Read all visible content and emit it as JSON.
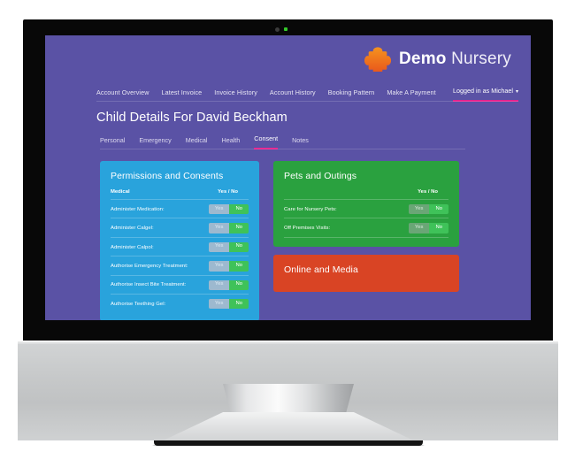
{
  "device": {
    "type": "desktop-monitor-mockup",
    "webcam_led_color": "#34c82a"
  },
  "site": {
    "brand_bold": "Demo",
    "brand_light": "Nursery",
    "logo_icon": "puzzle-piece-icon",
    "header_bg": "#5a52a5",
    "accent_pink": "#e91e8c"
  },
  "top_nav": {
    "links": [
      "Account Overview",
      "Latest Invoice",
      "Invoice History",
      "Account History",
      "Booking Pattern",
      "Make A Payment"
    ],
    "user_label": "Logged in as Michael",
    "caret": "▾"
  },
  "page": {
    "title": "Child Details For David Beckham",
    "tabs": [
      {
        "label": "Personal",
        "active": false
      },
      {
        "label": "Emergency",
        "active": false
      },
      {
        "label": "Medical",
        "active": false
      },
      {
        "label": "Health",
        "active": false
      },
      {
        "label": "Consent",
        "active": true
      },
      {
        "label": "Notes",
        "active": false
      }
    ]
  },
  "panels": {
    "permissions": {
      "title": "Permissions and Consents",
      "color": "#29a3dc",
      "section_header": "Medical",
      "yes_no_header": "Yes / No",
      "yes_label": "Yes",
      "no_label": "No",
      "rows": [
        {
          "label": "Administer Medication:",
          "selected": "No"
        },
        {
          "label": "Administer Calgel:",
          "selected": "No"
        },
        {
          "label": "Administer Calpol:",
          "selected": "No"
        },
        {
          "label": "Authorise Emergency Treatment:",
          "selected": "No"
        },
        {
          "label": "Authorise Insect Bite Treatment:",
          "selected": "No"
        },
        {
          "label": "Authorise Teething Gel:",
          "selected": "No"
        }
      ]
    },
    "pets": {
      "title": "Pets and Outings",
      "color": "#2aa13f",
      "yes_no_header": "Yes / No",
      "yes_label": "Yes",
      "no_label": "No",
      "rows": [
        {
          "label": "Care for Nursery Pets:",
          "selected": "No"
        },
        {
          "label": "Off Premises Visits:",
          "selected": "No"
        }
      ]
    },
    "online": {
      "title": "Online and Media",
      "color": "#d94424"
    }
  }
}
